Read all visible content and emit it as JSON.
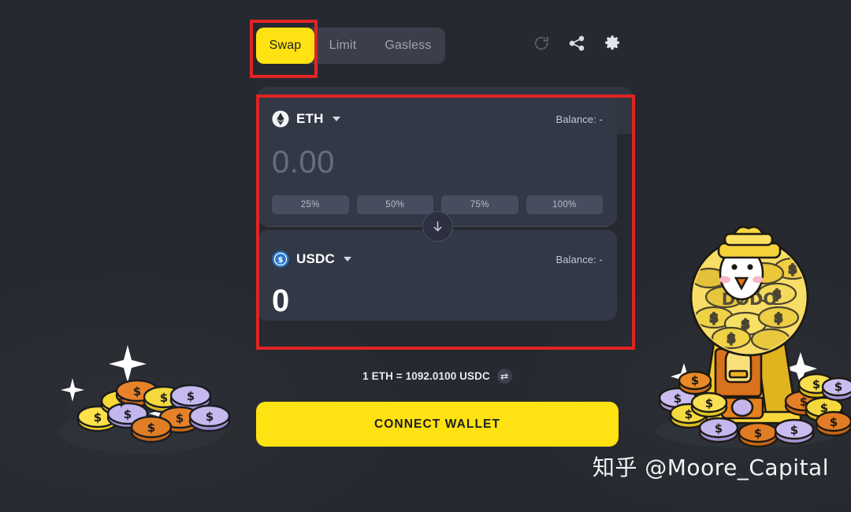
{
  "theme": {
    "page_bg": "#26292f",
    "card_bg": "#333847",
    "accent_yellow": "#ffe211",
    "annotation_red": "#e02424",
    "muted_text": "#9ea3af"
  },
  "tabs": [
    {
      "id": "swap",
      "label": "Swap",
      "active": true
    },
    {
      "id": "limit",
      "label": "Limit",
      "active": false
    },
    {
      "id": "gasless",
      "label": "Gasless",
      "active": false
    }
  ],
  "header_icons": [
    {
      "name": "refresh-icon",
      "title": "Refresh"
    },
    {
      "name": "share-icon",
      "title": "Share"
    },
    {
      "name": "gear-icon",
      "title": "Settings"
    }
  ],
  "from_panel": {
    "token_symbol": "ETH",
    "token_icon": "ethereum-icon",
    "balance_label": "Balance: -",
    "amount_placeholder": "0.00",
    "amount_value": "",
    "percent_buttons": [
      "25%",
      "50%",
      "75%",
      "100%"
    ]
  },
  "to_panel": {
    "token_symbol": "USDC",
    "token_icon": "usdc-icon",
    "balance_label": "Balance: -",
    "amount_value": "0"
  },
  "switch_direction": {
    "name": "swap-direction-arrow",
    "glyph": "down-arrow-icon"
  },
  "rate": {
    "text": "1 ETH = 1092.0100 USDC",
    "toggle_icon": "rate-invert-icon",
    "base_token": "ETH",
    "quote_token": "USDC",
    "price": "1092.0100"
  },
  "primary_action": {
    "label": "CONNECT WALLET"
  },
  "annotations": [
    {
      "name": "annotation-swap-tab",
      "target": "Swap tab"
    },
    {
      "name": "annotation-swap-card",
      "target": "Swap form card"
    }
  ],
  "watermark": {
    "text": "知乎 @Moore_Capital"
  },
  "decorations": {
    "left": "coin-pile-illustration",
    "right": "dodo-gumball-machine-illustration",
    "brand_text": "DODO"
  }
}
